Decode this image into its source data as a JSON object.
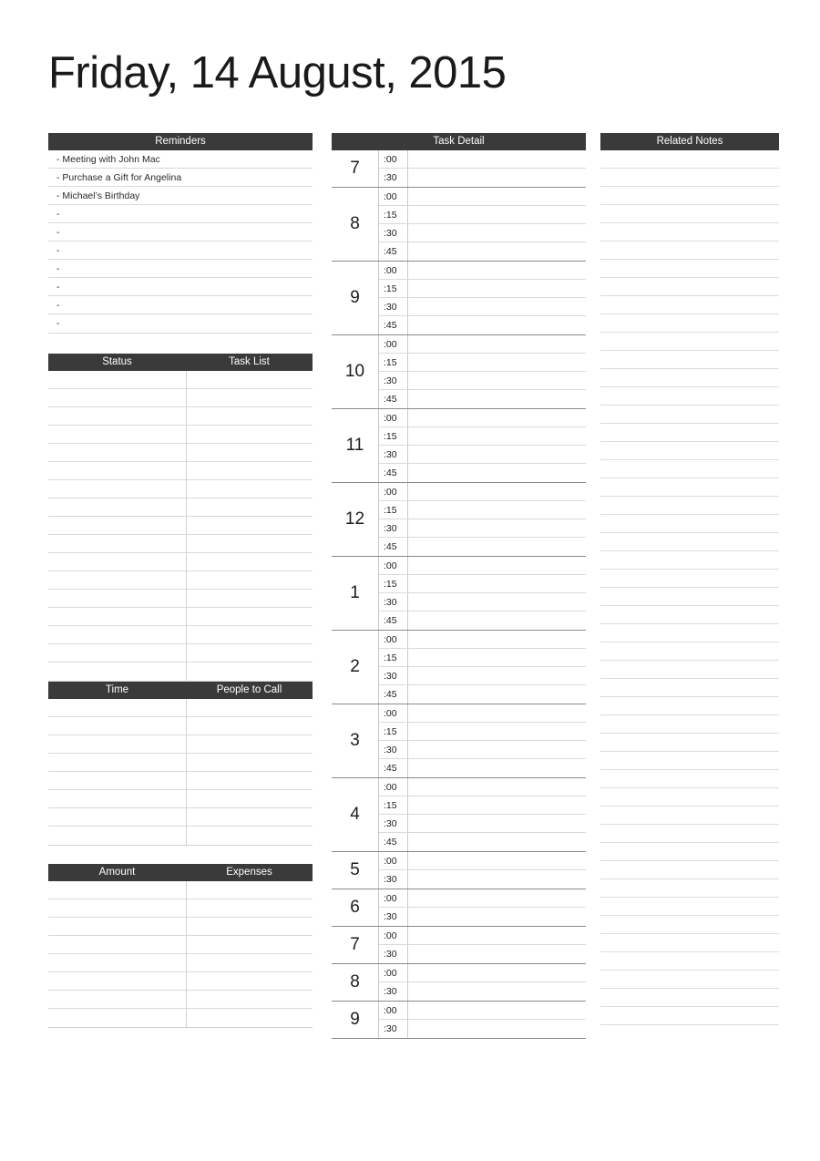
{
  "document": {
    "title": "Friday, 14 August, 2015",
    "type": "daily-planner"
  },
  "theme": {
    "header_bg": "#3a3a3a",
    "header_text": "#ffffff",
    "rule_line": "#d9d9d9",
    "group_divider": "#8a8a8a",
    "page_bg": "#ffffff",
    "body_text": "#231f20"
  },
  "reminders": {
    "header": "Reminders",
    "rows": [
      "- Meeting with John Mac",
      "- Purchase a Gift for Angelina",
      "- Michael’s Birthday",
      "-",
      "-",
      "-",
      "-",
      "-",
      "-",
      "-"
    ]
  },
  "task_list": {
    "header_left": "Status",
    "header_right": "Task List",
    "row_count": 17,
    "rows": [
      {
        "status": "",
        "task": ""
      },
      {
        "status": "",
        "task": ""
      },
      {
        "status": "",
        "task": ""
      },
      {
        "status": "",
        "task": ""
      },
      {
        "status": "",
        "task": ""
      },
      {
        "status": "",
        "task": ""
      },
      {
        "status": "",
        "task": ""
      },
      {
        "status": "",
        "task": ""
      },
      {
        "status": "",
        "task": ""
      },
      {
        "status": "",
        "task": ""
      },
      {
        "status": "",
        "task": ""
      },
      {
        "status": "",
        "task": ""
      },
      {
        "status": "",
        "task": ""
      },
      {
        "status": "",
        "task": ""
      },
      {
        "status": "",
        "task": ""
      },
      {
        "status": "",
        "task": ""
      },
      {
        "status": "",
        "task": ""
      }
    ]
  },
  "people_to_call": {
    "header_left": "Time",
    "header_right": "People to Call",
    "row_count": 8,
    "rows": [
      {
        "time": "",
        "person": ""
      },
      {
        "time": "",
        "person": ""
      },
      {
        "time": "",
        "person": ""
      },
      {
        "time": "",
        "person": ""
      },
      {
        "time": "",
        "person": ""
      },
      {
        "time": "",
        "person": ""
      },
      {
        "time": "",
        "person": ""
      },
      {
        "time": "",
        "person": ""
      }
    ]
  },
  "expenses": {
    "header_left": "Amount",
    "header_right": "Expenses",
    "row_count": 8,
    "rows": [
      {
        "amount": "",
        "expense": ""
      },
      {
        "amount": "",
        "expense": ""
      },
      {
        "amount": "",
        "expense": ""
      },
      {
        "amount": "",
        "expense": ""
      },
      {
        "amount": "",
        "expense": ""
      },
      {
        "amount": "",
        "expense": ""
      },
      {
        "amount": "",
        "expense": ""
      },
      {
        "amount": "",
        "expense": ""
      }
    ]
  },
  "task_detail": {
    "header": "Task Detail",
    "hours": [
      {
        "hour": "7",
        "slots": [
          ":00",
          ":30"
        ]
      },
      {
        "hour": "8",
        "slots": [
          ":00",
          ":15",
          ":30",
          ":45"
        ]
      },
      {
        "hour": "9",
        "slots": [
          ":00",
          ":15",
          ":30",
          ":45"
        ]
      },
      {
        "hour": "10",
        "slots": [
          ":00",
          ":15",
          ":30",
          ":45"
        ]
      },
      {
        "hour": "11",
        "slots": [
          ":00",
          ":15",
          ":30",
          ":45"
        ]
      },
      {
        "hour": "12",
        "slots": [
          ":00",
          ":15",
          ":30",
          ":45"
        ]
      },
      {
        "hour": "1",
        "slots": [
          ":00",
          ":15",
          ":30",
          ":45"
        ]
      },
      {
        "hour": "2",
        "slots": [
          ":00",
          ":15",
          ":30",
          ":45"
        ]
      },
      {
        "hour": "3",
        "slots": [
          ":00",
          ":15",
          ":30",
          ":45"
        ]
      },
      {
        "hour": "4",
        "slots": [
          ":00",
          ":15",
          ":30",
          ":45"
        ]
      },
      {
        "hour": "5",
        "slots": [
          ":00",
          ":30"
        ]
      },
      {
        "hour": "6",
        "slots": [
          ":00",
          ":30"
        ]
      },
      {
        "hour": "7",
        "slots": [
          ":00",
          ":30"
        ]
      },
      {
        "hour": "8",
        "slots": [
          ":00",
          ":30"
        ]
      },
      {
        "hour": "9",
        "slots": [
          ":00",
          ":30"
        ]
      }
    ]
  },
  "related_notes": {
    "header": "Related Notes",
    "line_count": 48,
    "lines": []
  }
}
